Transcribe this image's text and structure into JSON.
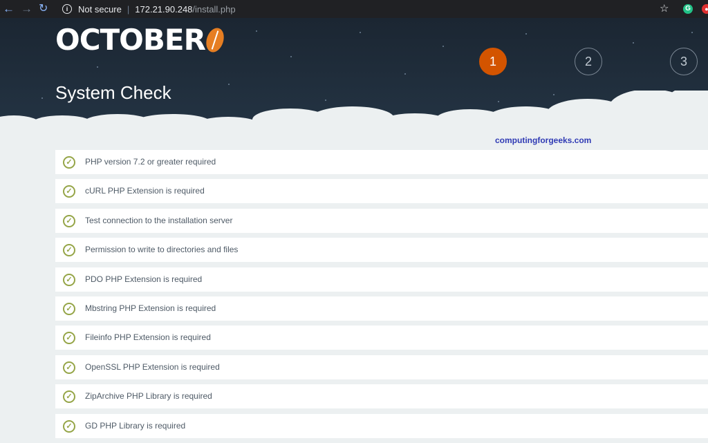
{
  "browser": {
    "back_icon": "arrow-left-icon",
    "forward_icon": "arrow-right-icon",
    "reload_icon": "reload-icon",
    "security_label": "Not secure",
    "url_host": "172.21.90.248",
    "url_path": "/install.php",
    "extension_green_glyph": "G",
    "extension_red_glyph": "●"
  },
  "installer": {
    "logo_text": "OCTOBER",
    "page_title": "System Check",
    "steps": [
      {
        "number": "1",
        "active": true
      },
      {
        "number": "2",
        "active": false
      },
      {
        "number": "3",
        "active": false
      }
    ],
    "watermark": "computingforgeeks.com",
    "checks": [
      {
        "label": "PHP version 7.2 or greater required",
        "status": "pass"
      },
      {
        "label": "cURL PHP Extension is required",
        "status": "pass"
      },
      {
        "label": "Test connection to the installation server",
        "status": "pass"
      },
      {
        "label": "Permission to write to directories and files",
        "status": "pass"
      },
      {
        "label": "PDO PHP Extension is required",
        "status": "pass"
      },
      {
        "label": "Mbstring PHP Extension is required",
        "status": "pass"
      },
      {
        "label": "Fileinfo PHP Extension is required",
        "status": "pass"
      },
      {
        "label": "OpenSSL PHP Extension is required",
        "status": "pass"
      },
      {
        "label": "ZipArchive PHP Library is required",
        "status": "pass"
      },
      {
        "label": "GD PHP Library is required",
        "status": "pass"
      }
    ]
  },
  "colors": {
    "accent": "#d35400",
    "check_green": "#95a547",
    "hero_dark": "#1b2632",
    "background": "#ecf0f1"
  }
}
